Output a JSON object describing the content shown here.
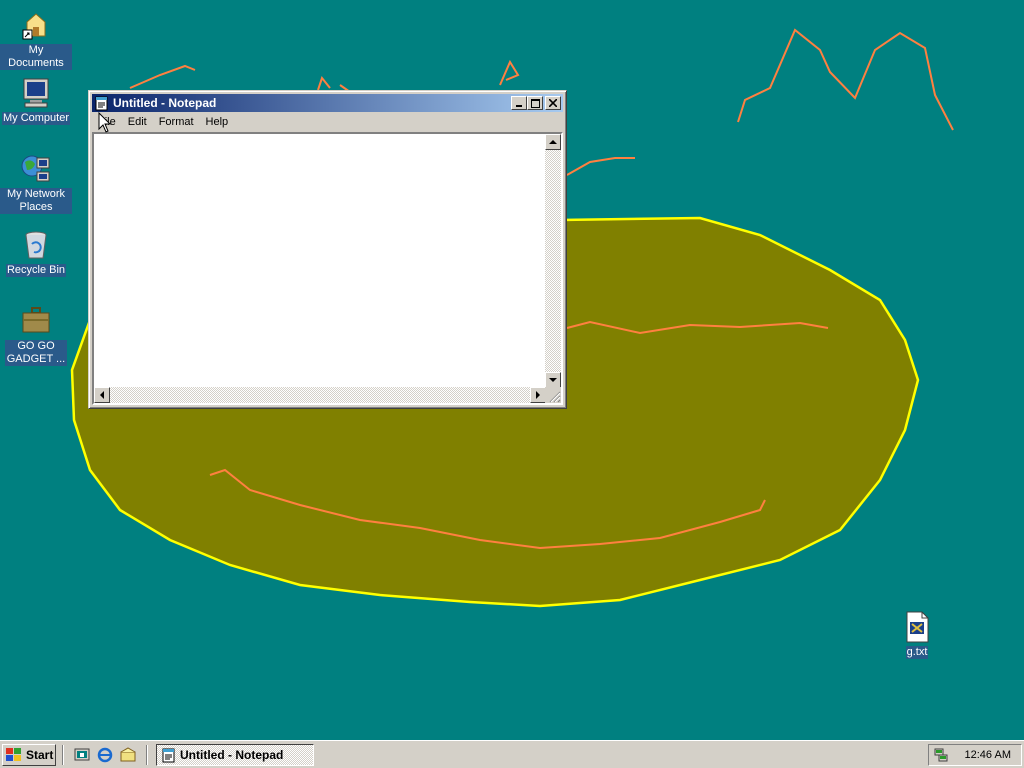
{
  "desktop": {
    "icons": [
      {
        "label": "My Documents",
        "icon": "my-documents-icon"
      },
      {
        "label": "My Computer",
        "icon": "my-computer-icon"
      },
      {
        "label": "My Network Places",
        "icon": "network-places-icon"
      },
      {
        "label": "Recycle Bin",
        "icon": "recycle-bin-icon"
      },
      {
        "label": "GO GO GADGET ...",
        "icon": "briefcase-icon"
      },
      {
        "label": "g.txt",
        "icon": "text-file-icon"
      }
    ],
    "colors": {
      "background": "#008080",
      "blob_fill": "#808000",
      "blob_outline": "#ffff00",
      "scribble": "#ff8040"
    }
  },
  "notepad": {
    "title": "Untitled - Notepad",
    "menu": [
      "File",
      "Edit",
      "Format",
      "Help"
    ],
    "content": ""
  },
  "taskbar": {
    "start_label": "Start",
    "quick_launch": [
      "show-desktop-icon",
      "internet-explorer-icon",
      "outlook-express-icon"
    ],
    "task_label": "Untitled - Notepad",
    "clock": "12:46 AM"
  }
}
